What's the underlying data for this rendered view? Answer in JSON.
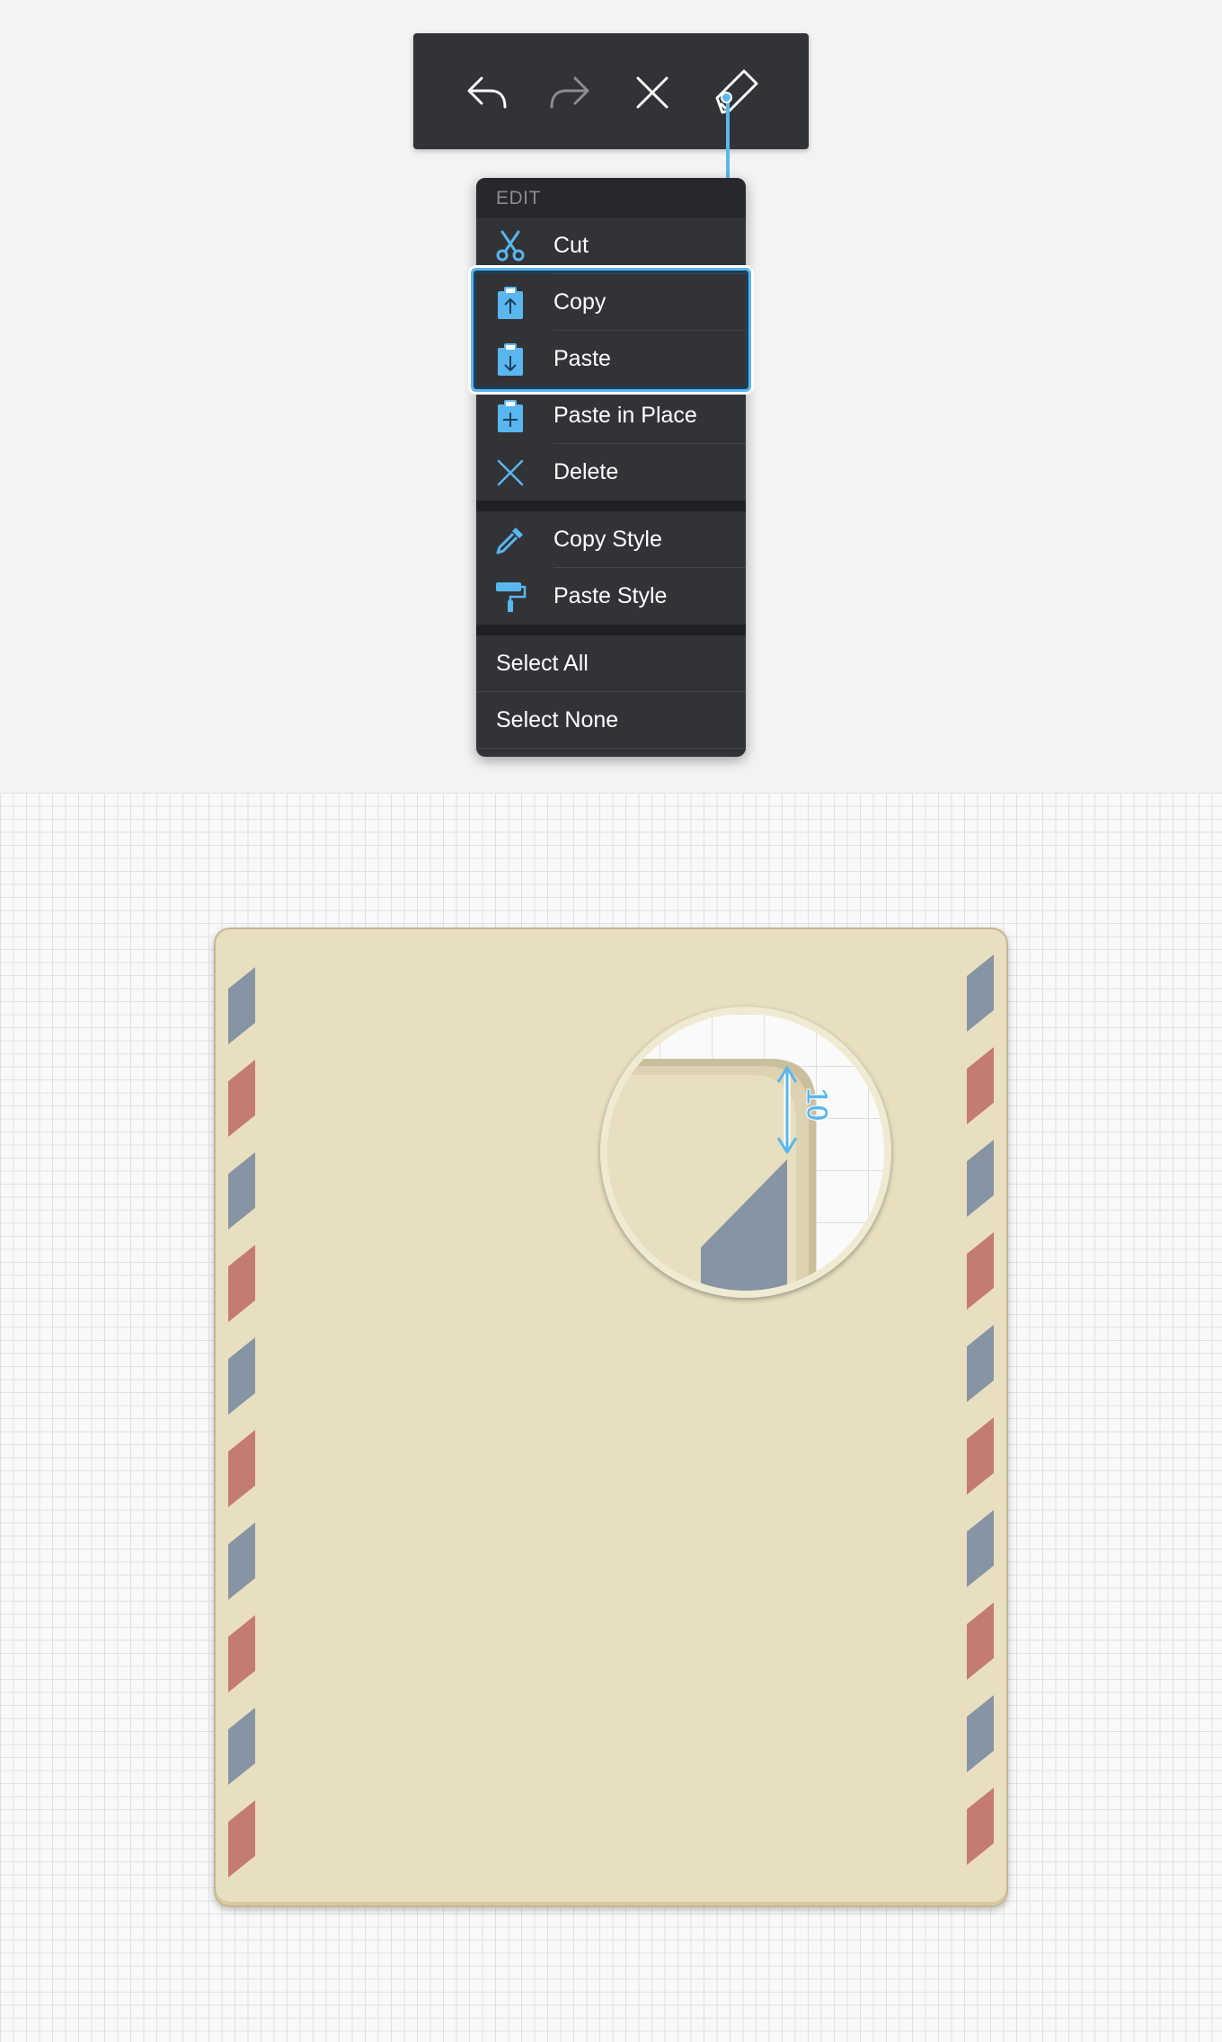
{
  "toolbar": {
    "buttons": [
      {
        "name": "undo-icon"
      },
      {
        "name": "redo-icon"
      },
      {
        "name": "close-icon"
      },
      {
        "name": "pen-icon"
      }
    ]
  },
  "menu": {
    "header": "EDIT",
    "group1": [
      {
        "label": "Cut",
        "icon": "scissors-icon"
      },
      {
        "label": "Copy",
        "icon": "clipboard-copy-icon"
      },
      {
        "label": "Paste",
        "icon": "clipboard-paste-icon"
      },
      {
        "label": "Paste in Place",
        "icon": "clipboard-plus-icon"
      },
      {
        "label": "Delete",
        "icon": "delete-icon"
      }
    ],
    "group2": [
      {
        "label": "Copy Style",
        "icon": "eyedropper-icon"
      },
      {
        "label": "Paste Style",
        "icon": "paint-roller-icon"
      }
    ],
    "group3": [
      {
        "label": "Select All"
      },
      {
        "label": "Select None"
      }
    ]
  },
  "magnifier": {
    "dimension_label": "10"
  },
  "colors": {
    "accent": "#5ab6ee",
    "menu_bg": "#323337",
    "envelope": "#e8dfc0",
    "stripe_blue": "#8694a4",
    "stripe_red": "#c47b72"
  }
}
